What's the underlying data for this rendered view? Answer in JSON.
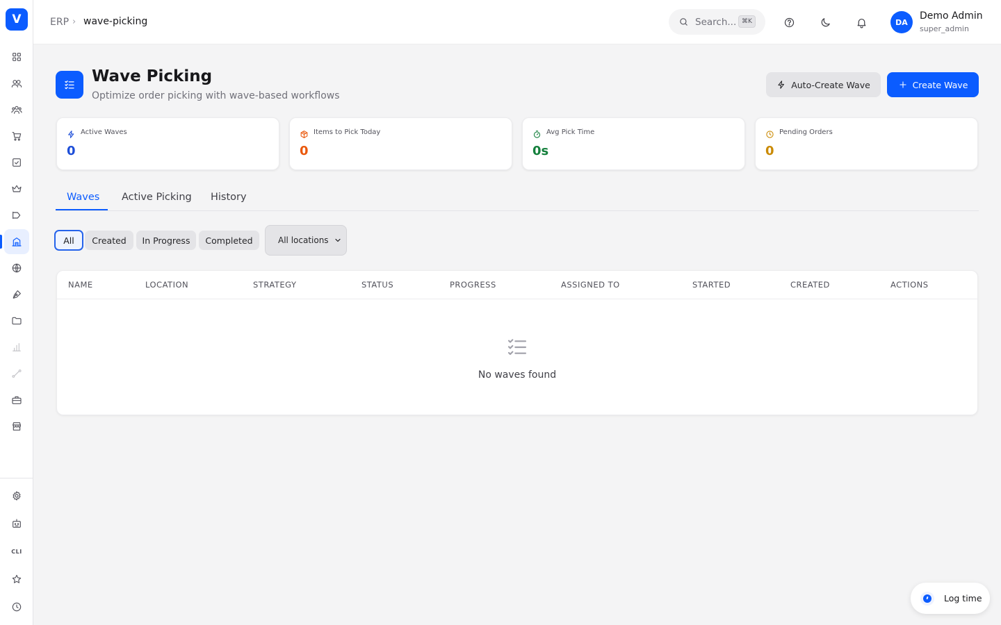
{
  "sidebar": {
    "logo_letter": "V",
    "items": [
      {
        "icon": "dashboard-grid-icon"
      },
      {
        "icon": "users-icon"
      },
      {
        "icon": "team-icon"
      },
      {
        "icon": "cart-icon"
      },
      {
        "icon": "checkbox-icon"
      },
      {
        "icon": "crown-icon"
      },
      {
        "icon": "megaphone-icon"
      },
      {
        "icon": "warehouse-icon",
        "active": true
      },
      {
        "icon": "globe-icon"
      },
      {
        "icon": "pen-tool-icon"
      },
      {
        "icon": "folder-icon"
      },
      {
        "icon": "bar-chart-icon",
        "dim": true
      },
      {
        "icon": "route-icon",
        "dim": true
      },
      {
        "icon": "briefcase-icon"
      },
      {
        "icon": "store-icon"
      }
    ],
    "bottom_items": [
      {
        "icon": "settings-gear-icon"
      },
      {
        "icon": "bot-icon"
      },
      {
        "icon": "cli-icon",
        "label": "CLI"
      },
      {
        "icon": "star-icon"
      },
      {
        "icon": "clock-icon"
      }
    ]
  },
  "header": {
    "breadcrumb_root": "ERP",
    "breadcrumb_current": "wave-picking",
    "search_placeholder": "Search...",
    "search_shortcut": "⌘K",
    "user_initials": "DA",
    "user_name": "Demo Admin",
    "user_role": "super_admin"
  },
  "page": {
    "title": "Wave Picking",
    "subtitle": "Optimize order picking with wave-based workflows",
    "auto_create_label": "Auto-Create Wave",
    "create_label": "Create Wave"
  },
  "stats": [
    {
      "label": "Active Waves",
      "value": "0",
      "color": "#1d4ed8",
      "icon": "lightning-icon"
    },
    {
      "label": "Items to Pick Today",
      "value": "0",
      "color": "#ea580c",
      "icon": "package-icon"
    },
    {
      "label": "Avg Pick Time",
      "value": "0s",
      "color": "#15803d",
      "icon": "timer-icon"
    },
    {
      "label": "Pending Orders",
      "value": "0",
      "color": "#ca8a04",
      "icon": "clock-icon"
    }
  ],
  "tabs": [
    {
      "label": "Waves",
      "active": true
    },
    {
      "label": "Active Picking"
    },
    {
      "label": "History"
    }
  ],
  "filters": {
    "chips": [
      {
        "label": "All",
        "active": true
      },
      {
        "label": "Created"
      },
      {
        "label": "In Progress"
      },
      {
        "label": "Completed"
      }
    ],
    "location_selected": "All locations"
  },
  "table": {
    "columns": [
      "NAME",
      "LOCATION",
      "STRATEGY",
      "STATUS",
      "PROGRESS",
      "ASSIGNED TO",
      "STARTED",
      "CREATED",
      "ACTIONS"
    ],
    "empty_text": "No waves found"
  },
  "log_time_label": "Log time",
  "colors": {
    "accent": "#0b5cff",
    "background": "#f4f4f5"
  }
}
